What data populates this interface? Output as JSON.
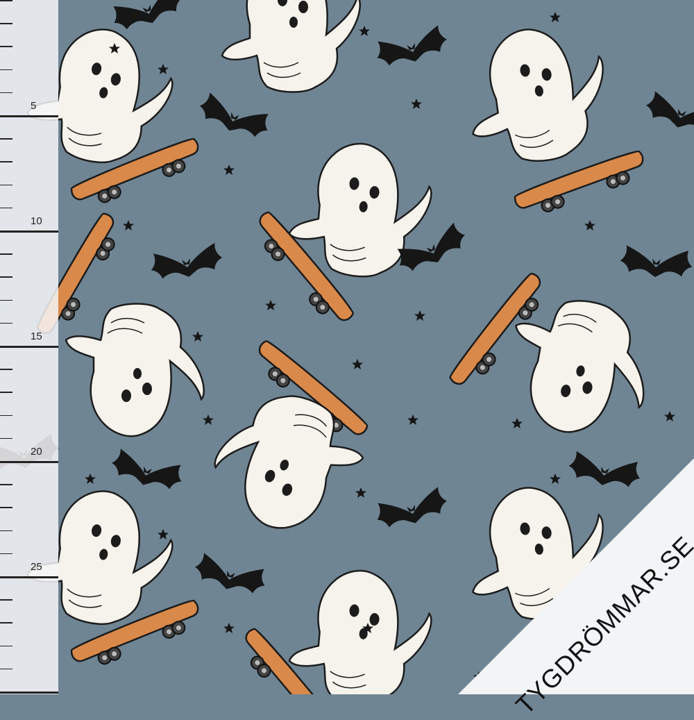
{
  "fabric": {
    "background": "#6f8594",
    "motifs": [
      "ghost-on-skateboard",
      "bat-icon",
      "star-icon"
    ],
    "colors": {
      "ghost": "#f6f3ec",
      "skateboard": "#d9894a",
      "outline": "#1c1c1c",
      "bat": "#161616",
      "star": "#161616"
    }
  },
  "ruler": {
    "labels": [
      "5",
      "10",
      "15",
      "20",
      "25"
    ]
  },
  "brand": {
    "text": "TYGDRÖMMAR.SE",
    "banner_color": "#f2f4f6"
  }
}
